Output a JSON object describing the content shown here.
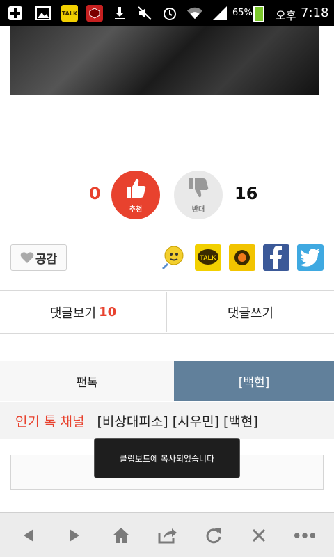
{
  "status_bar": {
    "battery": "65%",
    "time_prefix": "오후",
    "time": "7:18"
  },
  "votes": {
    "recommend_count": "0",
    "recommend_label": "추천",
    "oppose_count": "16",
    "oppose_label": "반대"
  },
  "empathy": {
    "label": "공감"
  },
  "comments": {
    "view_label": "댓글보기",
    "view_count": "10",
    "write_label": "댓글쓰기"
  },
  "tabs": {
    "left": "팬톡",
    "right": "[백현]"
  },
  "popular": {
    "title": "인기 톡 채널",
    "channels": "[비상대피소] [시우민] [백현]"
  },
  "toast": {
    "message": "클립보드에 복사되었습니다"
  },
  "colors": {
    "accent_red": "#e8422e",
    "tab_blue": "#61809b"
  }
}
